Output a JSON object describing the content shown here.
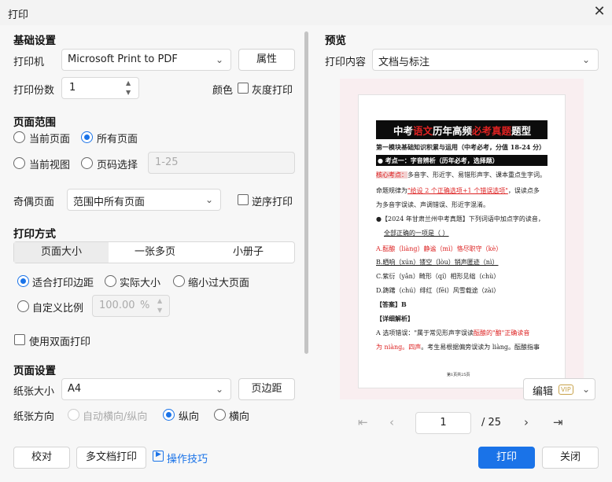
{
  "window": {
    "title": "打印",
    "close_glyph": "✕"
  },
  "basic": {
    "section": "基础设置",
    "printer_label": "打印机",
    "printer_value": "Microsoft Print to PDF",
    "properties_btn": "属性",
    "copies_label": "打印份数",
    "copies_value": "1",
    "color_label": "颜色",
    "grayscale_label": "灰度打印"
  },
  "range": {
    "section": "页面范围",
    "current_page": "当前页面",
    "all_pages": "所有页面",
    "current_view": "当前视图",
    "page_select": "页码选择",
    "page_select_placeholder": "1-25",
    "odd_even_label": "奇偶页面",
    "odd_even_value": "范围中所有页面",
    "reverse_label": "逆序打印"
  },
  "method": {
    "section": "打印方式",
    "tabs": [
      "页面大小",
      "一张多页",
      "小册子"
    ],
    "fit_margin": "适合打印边距",
    "actual_size": "实际大小",
    "shrink": "缩小过大页面",
    "custom_scale": "自定义比例",
    "scale_value": "100.00",
    "scale_unit": "%",
    "duplex": "使用双面打印"
  },
  "page_setup": {
    "section": "页面设置",
    "paper_label": "纸张大小",
    "paper_value": "A4",
    "margins_btn": "页边距",
    "orientation_label": "纸张方向",
    "auto": "自动横向/纵向",
    "portrait": "纵向",
    "landscape": "横向"
  },
  "bottom": {
    "proofread": "校对",
    "multi_doc": "多文档打印",
    "tips": "操作技巧",
    "print": "打印",
    "close": "关闭"
  },
  "preview": {
    "section": "预览",
    "content_label": "打印内容",
    "content_value": "文档与标注",
    "edit_label": "编辑",
    "vip_badge": "VIP",
    "page_current": "1",
    "page_total": "/ 25"
  },
  "doc": {
    "title_a": "中考",
    "title_b": "语文",
    "title_c": "历年高频",
    "title_d": "必考真题",
    "title_e": "题型",
    "l1": "第一模块基础知识积累与运用（中考必考，分值 18-24 分）",
    "l2": "● 考点一：字音辨析（历年必考，选择题）",
    "l3a": "核心考点：",
    "l3b": "多音字、形近字、易错形声字、课本重点生字词。",
    "l4a": "命题规律为",
    "l4b": "\"给设 2 个正确选项+1 个错误选项\"",
    "l4c": "，误读点多",
    "l5": "为多音字误读、声调错误、形近字混淆。",
    "l6": "●【2024 年甘肃兰州中考真题】下列词语中加点字的读音，",
    "l7": "全部正确的一项是（ ）",
    "l8": "A.酝酿（liàng）静谧（mì）恪尽职守（kè）",
    "l9": "B.晒响（xún）镂空（lòu）销声匿迹（nì）",
    "l10": "C.紫衍（yǎn）畸形（qí）相形见绌（chù）",
    "l11": "D.踌躇（chú）绯红（fēi）风雪载途（zài）",
    "l12": "【答案】B",
    "l13": "【详细解析】",
    "l14a": "A 选项错误：\"属于常见形声字误读",
    "l14b": "酝酿",
    "l14c": "的\"酿\"正确读音",
    "l15a": "为 niàng。四声",
    "l15b": "。考生易根据偏旁误读为 liàng。酝酿指事",
    "footer": "第1页共25页"
  }
}
